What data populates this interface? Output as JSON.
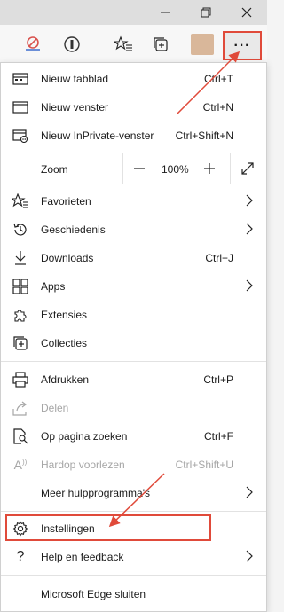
{
  "titlebar": {
    "minimize_label": "—",
    "maximize_label": "restore",
    "close_label": "✕"
  },
  "toolbar": {
    "more_label": "···"
  },
  "menu": {
    "items": [
      {
        "label": "Nieuw tabblad",
        "shortcut": "Ctrl+T"
      },
      {
        "label": "Nieuw venster",
        "shortcut": "Ctrl+N"
      },
      {
        "label": "Nieuw InPrivate-venster",
        "shortcut": "Ctrl+Shift+N"
      }
    ],
    "zoom": {
      "label": "Zoom",
      "minus": "—",
      "value": "100%",
      "plus": "+"
    },
    "group2": [
      {
        "label": "Favorieten",
        "has_submenu": true
      },
      {
        "label": "Geschiedenis",
        "has_submenu": true
      },
      {
        "label": "Downloads",
        "shortcut": "Ctrl+J"
      },
      {
        "label": "Apps",
        "has_submenu": true
      },
      {
        "label": "Extensies"
      },
      {
        "label": "Collecties"
      }
    ],
    "group3": [
      {
        "label": "Afdrukken",
        "shortcut": "Ctrl+P"
      },
      {
        "label": "Delen",
        "disabled": true
      },
      {
        "label": "Op pagina zoeken",
        "shortcut": "Ctrl+F"
      },
      {
        "label": "Hardop voorlezen",
        "shortcut": "Ctrl+Shift+U",
        "disabled": true
      },
      {
        "label": "Meer hulpprogramma's",
        "has_submenu": true
      }
    ],
    "group4": [
      {
        "label": "Instellingen"
      },
      {
        "label": "Help en feedback",
        "has_submenu": true
      }
    ],
    "close_edge": "Microsoft Edge sluiten"
  },
  "colors": {
    "highlight": "#e04a3a",
    "menu_bg": "#ffffff",
    "titlebar_bg": "#dedede"
  }
}
